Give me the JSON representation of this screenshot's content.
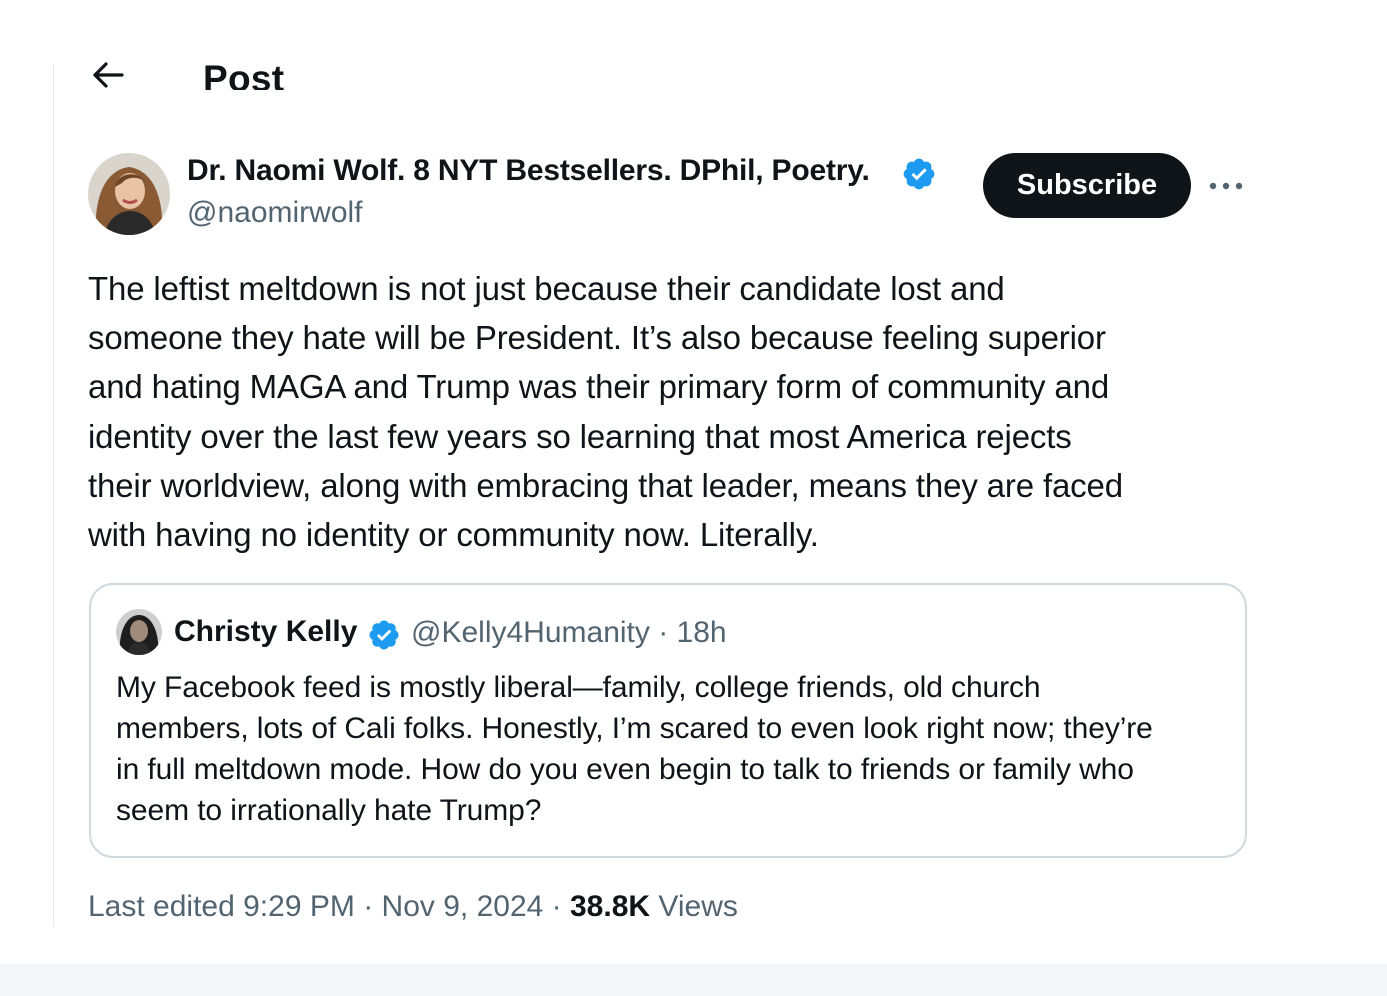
{
  "header": {
    "title": "Post"
  },
  "author": {
    "name": "Dr. Naomi Wolf. 8 NYT Bestsellers. DPhil, Poetry.",
    "handle": "@naomirwolf",
    "verified": true
  },
  "actions": {
    "subscribe_label": "Subscribe"
  },
  "tweet": {
    "lines": [
      "The leftist meltdown is not just because their candidate lost and",
      "someone they hate will be President. It’s also because feeling superior",
      "and hating MAGA and Trump was their primary form of community and",
      "identity over the last few years so learning that most America rejects",
      "their worldview, along with embracing that leader, means they are faced",
      "with having no identity or community now. Literally."
    ]
  },
  "quote": {
    "name": "Christy Kelly",
    "handle": "@Kelly4Humanity",
    "time": "18h",
    "lines": [
      "My Facebook feed is mostly liberal—family, college friends, old church",
      "members, lots of Cali folks. Honestly, I’m scared to even look right now; they’re",
      "in full meltdown mode. How do you even begin to talk to friends or family who",
      "seem to irrationally hate Trump?"
    ]
  },
  "meta": {
    "edited_label": "Last edited",
    "time": "9:29 PM",
    "date": "Nov 9, 2024",
    "views_count": "38.8K",
    "views_label": "Views"
  },
  "colors": {
    "text": "#0f1419",
    "secondary": "#536471",
    "verified": "#1d9bf0",
    "border": "#cfd9de",
    "button_bg": "#0f1419"
  },
  "icons": {
    "back": "arrow-left-icon",
    "verified": "verified-badge-icon",
    "more": "more-horizontal-icon"
  }
}
